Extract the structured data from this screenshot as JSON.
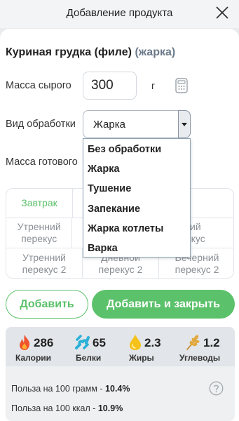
{
  "header": {
    "title": "Добавление продукта"
  },
  "product": {
    "name": "Куриная грудка (филе)",
    "mode": "(жарка)"
  },
  "form": {
    "raw_mass_label": "Масса сырого",
    "raw_mass_value": "300",
    "unit": "г",
    "processing_label": "Вид обработки",
    "processing_value": "Жарка",
    "cooked_mass_label": "Масса готового"
  },
  "dropdown": {
    "options": [
      "Без обработки",
      "Жарка",
      "Тушение",
      "Запекание",
      "Жарка котлеты",
      "Варка"
    ]
  },
  "meals": {
    "row1": [
      "Завтрак",
      "",
      "Ужин"
    ],
    "row1_visible": [
      "Завтрак",
      "жин"
    ],
    "row2": [
      "Утренний\nперекус",
      "",
      "Вечерний\nперекус"
    ],
    "row2_visible": [
      "Утренний перекус",
      "ерний перекус"
    ],
    "row3_visible": [
      "Утренний перекус 2",
      "Дневной перекус 2",
      "Вечерний перекус 2"
    ]
  },
  "buttons": {
    "add": "Добавить",
    "add_close": "Добавить и закрыть"
  },
  "nutrition": {
    "calories": {
      "value": "286",
      "label": "Калории"
    },
    "protein": {
      "value": "65",
      "label": "Белки"
    },
    "fat": {
      "value": "2.3",
      "label": "Жиры"
    },
    "carbs": {
      "value": "1.2",
      "label": "Углеводы"
    }
  },
  "benefit": {
    "per_100g_label": "Польза на 100 грамм - ",
    "per_100g_value": "10.4%",
    "per_100kcal_label": "Польза на 100 ккал - ",
    "per_100kcal_value": "10.9%"
  },
  "colors": {
    "accent": "#5cc16b",
    "calories_icon": "#f0542d",
    "protein_icon": "#2ab0d8",
    "fat_icon": "#f5c21b",
    "carbs_icon": "#d9a441"
  }
}
